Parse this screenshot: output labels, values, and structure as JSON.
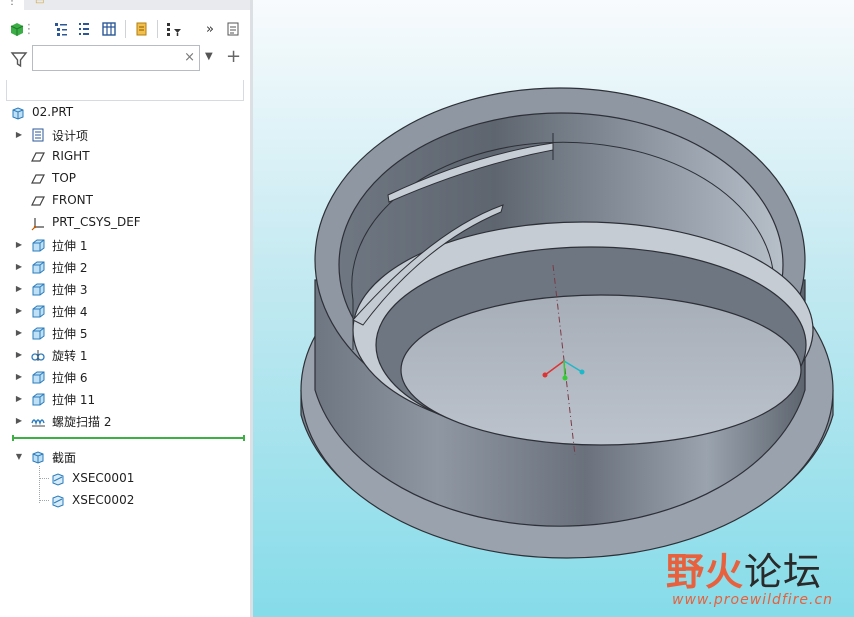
{
  "toolbar": {
    "icons": [
      "show-icon",
      "tree-columns-icon",
      "expand-tree-icon",
      "column-settings-icon",
      "note-icon",
      "settings-filter-icon",
      "more-icon",
      "properties-icon"
    ]
  },
  "filter": {
    "placeholder": "",
    "value": "",
    "clear_symbol": "×"
  },
  "tree": {
    "root": "02.PRT",
    "items": [
      {
        "label": "设计项",
        "icon": "design-items-icon",
        "expandable": true
      },
      {
        "label": "RIGHT",
        "icon": "datum-plane-icon",
        "expandable": false
      },
      {
        "label": "TOP",
        "icon": "datum-plane-icon",
        "expandable": false
      },
      {
        "label": "FRONT",
        "icon": "datum-plane-icon",
        "expandable": false
      },
      {
        "label": "PRT_CSYS_DEF",
        "icon": "coordinate-system-icon",
        "expandable": false
      },
      {
        "label": "拉伸 1",
        "icon": "extrude-icon",
        "expandable": true
      },
      {
        "label": "拉伸 2",
        "icon": "extrude-icon",
        "expandable": true
      },
      {
        "label": "拉伸 3",
        "icon": "extrude-icon",
        "expandable": true
      },
      {
        "label": "拉伸 4",
        "icon": "extrude-icon",
        "expandable": true
      },
      {
        "label": "拉伸 5",
        "icon": "extrude-icon",
        "expandable": true
      },
      {
        "label": "旋转 1",
        "icon": "revolve-icon",
        "expandable": true
      },
      {
        "label": "拉伸 6",
        "icon": "extrude-icon",
        "expandable": true
      },
      {
        "label": "拉伸 11",
        "icon": "extrude-icon",
        "expandable": true
      },
      {
        "label": "螺旋扫描 2",
        "icon": "helical-sweep-icon",
        "expandable": true
      }
    ],
    "sections": {
      "label": "截面",
      "expanded": true,
      "children": [
        "XSEC0001",
        "XSEC0002"
      ]
    }
  },
  "watermark": {
    "brand_first": "野火",
    "brand_rest": "论坛",
    "url": "www.proewildfire.cn"
  },
  "colors": {
    "viewport_top": "#f8fbfd",
    "viewport_bottom": "#86dce9",
    "model_body": "#8a929e",
    "insert_line": "#3cb043",
    "watermark": "#e8603c"
  }
}
